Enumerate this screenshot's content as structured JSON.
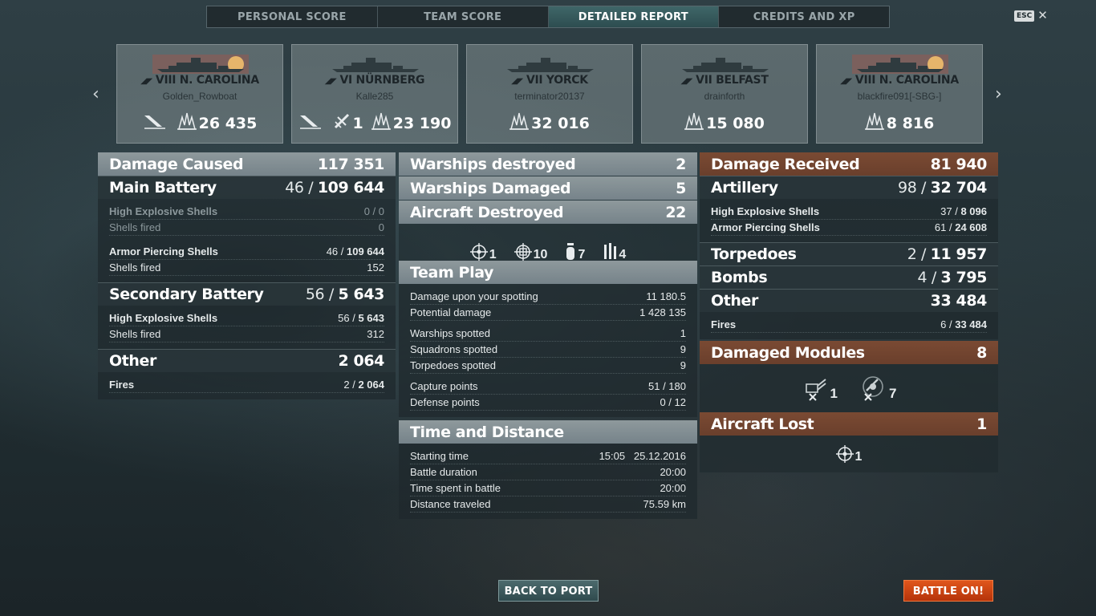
{
  "tabs": [
    {
      "label": "PERSONAL SCORE"
    },
    {
      "label": "TEAM SCORE"
    },
    {
      "label": "DETAILED REPORT"
    },
    {
      "label": "CREDITS AND XP"
    }
  ],
  "esc": {
    "key": "ESC",
    "close": "✕"
  },
  "nav": {
    "prev": "‹",
    "next": "›"
  },
  "cards": [
    {
      "tier": "VIII",
      "ship": "N. CAROLINA",
      "player": "Golden_Rowboat",
      "stats": [
        {
          "icon": "sunk-ship-icon",
          "value": ""
        },
        {
          "icon": "damage-burst-icon",
          "value": "26 435"
        }
      ]
    },
    {
      "tier": "VI",
      "ship": "NÜRNBERG",
      "player": "Kalle285",
      "stats": [
        {
          "icon": "sunk-ship-icon",
          "value": ""
        },
        {
          "icon": "plane-shot-icon",
          "value": "1"
        },
        {
          "icon": "damage-burst-icon",
          "value": "23 190"
        }
      ]
    },
    {
      "tier": "VII",
      "ship": "YORCK",
      "player": "terminator20137",
      "stats": [
        {
          "icon": "damage-burst-icon",
          "value": "32 016"
        }
      ]
    },
    {
      "tier": "VII",
      "ship": "BELFAST",
      "player": "drainforth",
      "stats": [
        {
          "icon": "damage-burst-icon",
          "value": "15 080"
        }
      ]
    },
    {
      "tier": "VIII",
      "ship": "N. CAROLINA",
      "player": "blackfire091[-SBG-]",
      "stats": [
        {
          "icon": "damage-burst-icon",
          "value": "8 816"
        }
      ]
    }
  ],
  "left": {
    "damage_caused": {
      "label": "Damage Caused",
      "value": "117 351"
    },
    "main_battery": {
      "label": "Main Battery",
      "hits": "46",
      "sep": " / ",
      "total": "109 644"
    },
    "main_rows_he": [
      {
        "label": "High Explosive Shells",
        "a": "0",
        "sep": " / ",
        "b": "0"
      },
      {
        "label": "Shells fired",
        "value": "0"
      }
    ],
    "main_rows_ap": [
      {
        "label": "Armor Piercing Shells",
        "a": "46",
        "sep": " / ",
        "b": "109 644"
      },
      {
        "label": "Shells fired",
        "value": "152"
      }
    ],
    "secondary": {
      "label": "Secondary Battery",
      "hits": "56",
      "sep": " / ",
      "total": "5 643"
    },
    "secondary_rows": [
      {
        "label": "High Explosive Shells",
        "a": "56",
        "sep": " / ",
        "b": "5 643"
      },
      {
        "label": "Shells fired",
        "value": "312"
      }
    ],
    "other": {
      "label": "Other",
      "value": "2 064"
    },
    "other_rows": [
      {
        "label": "Fires",
        "a": "2",
        "sep": " / ",
        "b": "2 064"
      }
    ]
  },
  "mid": {
    "warships_destroyed": {
      "label": "Warships destroyed",
      "value": "2"
    },
    "warships_damaged": {
      "label": "Warships Damaged",
      "value": "5"
    },
    "aircraft_destroyed": {
      "label": "Aircraft Destroyed",
      "value": "22"
    },
    "aircraft_icons": [
      {
        "icon": "fighter-crosshair-icon",
        "value": "1"
      },
      {
        "icon": "torpedo-bomber-crosshair-icon",
        "value": "10"
      },
      {
        "icon": "bomb-icon",
        "value": "7"
      },
      {
        "icon": "torpedo-icon",
        "value": "4"
      }
    ],
    "team_play": {
      "label": "Team Play"
    },
    "team_rows_1": [
      {
        "label": "Damage upon your spotting",
        "value": "11 180.5"
      },
      {
        "label": "Potential damage",
        "value": "1 428 135"
      }
    ],
    "team_rows_2": [
      {
        "label": "Warships spotted",
        "value": "1"
      },
      {
        "label": "Squadrons spotted",
        "value": "9"
      },
      {
        "label": "Torpedoes spotted",
        "value": "9"
      }
    ],
    "team_rows_3": [
      {
        "label": "Capture points",
        "value": "51 / 180"
      },
      {
        "label": "Defense points",
        "value": "0 / 12"
      }
    ],
    "time_distance": {
      "label": "Time and Distance"
    },
    "time_rows": [
      {
        "label": "Starting time",
        "value": "15:05   25.12.2016"
      },
      {
        "label": "Battle duration",
        "value": "20:00"
      },
      {
        "label": "Time spent in battle",
        "value": "20:00"
      },
      {
        "label": "Distance traveled",
        "value": "75.59 km"
      }
    ]
  },
  "right": {
    "damage_received": {
      "label": "Damage Received",
      "value": "81 940"
    },
    "artillery": {
      "label": "Artillery",
      "hits": "98",
      "sep": " / ",
      "total": "32 704"
    },
    "artillery_rows": [
      {
        "label": "High Explosive Shells",
        "a": "37",
        "sep": " / ",
        "b": "8 096"
      },
      {
        "label": "Armor Piercing Shells",
        "a": "61",
        "sep": " / ",
        "b": "24 608"
      }
    ],
    "torpedoes": {
      "label": "Torpedoes",
      "hits": "2",
      "sep": " / ",
      "total": "11 957"
    },
    "bombs": {
      "label": "Bombs",
      "hits": "4",
      "sep": " / ",
      "total": "3 795"
    },
    "other": {
      "label": "Other",
      "value": "33 484"
    },
    "other_rows": [
      {
        "label": "Fires",
        "a": "6",
        "sep": " / ",
        "b": "33 484"
      }
    ],
    "damaged_modules": {
      "label": "Damaged Modules",
      "value": "8"
    },
    "modules": [
      {
        "icon": "turret-destroyed-icon",
        "value": "1"
      },
      {
        "icon": "aa-gun-destroyed-icon",
        "value": "7"
      }
    ],
    "aircraft_lost": {
      "label": "Aircraft Lost",
      "value": "1"
    },
    "aircraft_lost_icon": {
      "icon": "fighter-crosshair-icon",
      "value": "1"
    }
  },
  "buttons": {
    "back": "BACK TO PORT",
    "battle": "BATTLE ON!"
  },
  "colors": {
    "accent_tab": "#3f6668",
    "rust_header": "#7a4a33",
    "battle_button": "#d04514"
  }
}
